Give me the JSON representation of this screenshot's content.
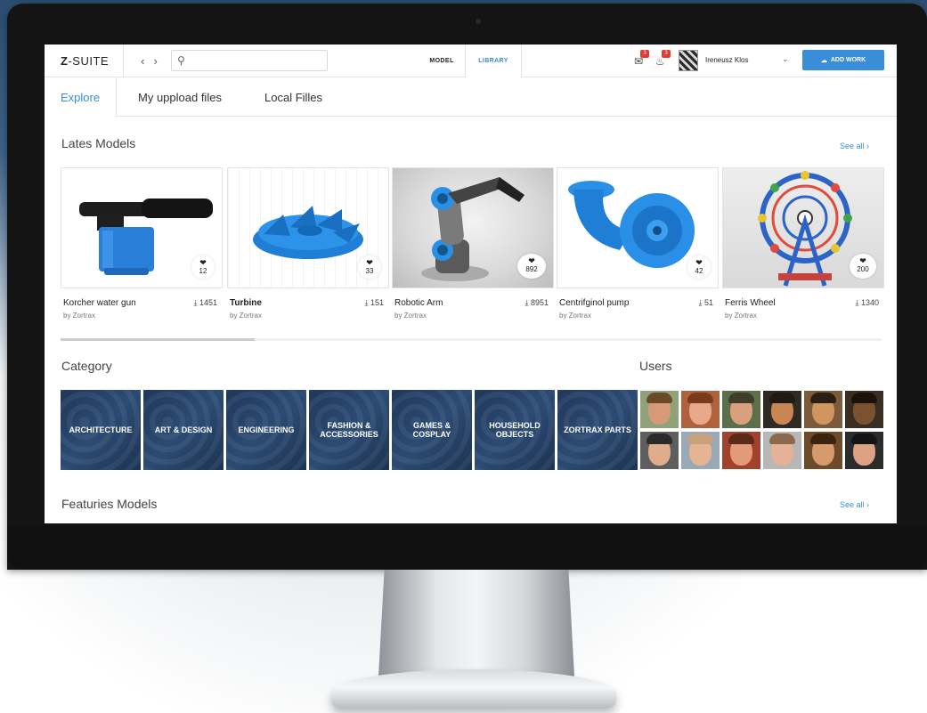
{
  "app": {
    "brand_prefix": "Z",
    "brand_suffix": "-SUITE"
  },
  "nav": {
    "back_icon": "chevron-left",
    "forward_icon": "chevron-right"
  },
  "search": {
    "placeholder": "",
    "value": ""
  },
  "modes": {
    "model": "MODEL",
    "library": "LIBRARY"
  },
  "notifications": [
    {
      "icon": "chat-icon",
      "badge": "3"
    },
    {
      "icon": "bell-icon",
      "badge": "3"
    }
  ],
  "user": {
    "name": "Ireneusz Klos"
  },
  "add_work": {
    "label": "ADD WORK"
  },
  "tabs": [
    {
      "label": "Explore",
      "active": true
    },
    {
      "label": "My uppload files"
    },
    {
      "label": "Local Filles"
    }
  ],
  "latest": {
    "title": "Lates Models",
    "see_all": "See all",
    "models": [
      {
        "name": "Korcher water gun",
        "by": "by Zortrax",
        "downloads": "1451",
        "likes": "12"
      },
      {
        "name": "Turbine",
        "by": "by Zortrax",
        "downloads": "151",
        "likes": "33"
      },
      {
        "name": "Robotic Arm",
        "by": "by Zortrax",
        "downloads": "8951",
        "likes": "892"
      },
      {
        "name": "Centrifginol pump",
        "by": "by Zortrax",
        "downloads": "51",
        "likes": "42"
      },
      {
        "name": "Ferris Wheel",
        "by": "by Zortrax",
        "downloads": "1340",
        "likes": "200"
      }
    ]
  },
  "category": {
    "title": "Category",
    "items": [
      "ARCHITECTURE",
      "ART & DESIGN",
      "ENGINEERING",
      "FASHION & ACCESSORIES",
      "GAMES & COSPLAY",
      "HOUSEHOLD OBJECTS",
      "ZORTRAX PARTS"
    ]
  },
  "users": {
    "title": "Users"
  },
  "featured": {
    "title": "Featuries Models",
    "see_all": "See all"
  },
  "colors": {
    "accent": "#3a8ed8",
    "category_tile": "#20375a",
    "badge": "#e53935"
  }
}
